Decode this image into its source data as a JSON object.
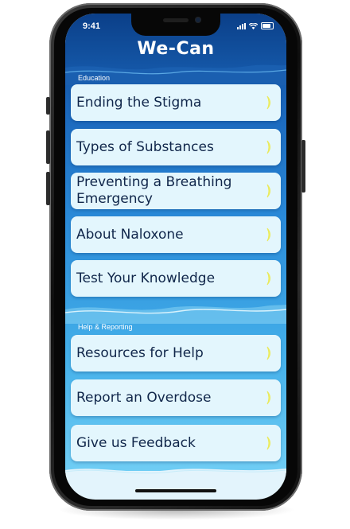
{
  "status_bar": {
    "time": "9:41"
  },
  "app": {
    "title": "We-Can"
  },
  "sections": [
    {
      "label": "Education",
      "items": [
        {
          "label": "Ending the Stigma"
        },
        {
          "label": "Types of Substances"
        },
        {
          "label": "Preventing a Breathing Emergency"
        },
        {
          "label": "About Naloxone"
        },
        {
          "label": "Test Your Knowledge"
        }
      ]
    },
    {
      "label": "Help & Reporting",
      "items": [
        {
          "label": "Resources for Help"
        },
        {
          "label": "Report an Overdose"
        },
        {
          "label": "Give us Feedback"
        }
      ]
    }
  ],
  "colors": {
    "header_blue": "#0b3f88",
    "item_background": "#e3f6fd",
    "item_text": "#10264a",
    "chevron": "#f4f27a"
  },
  "icons": {
    "chevron": "chevron-right-icon",
    "signal": "cellular-signal-icon",
    "wifi": "wifi-icon",
    "battery": "battery-icon"
  }
}
